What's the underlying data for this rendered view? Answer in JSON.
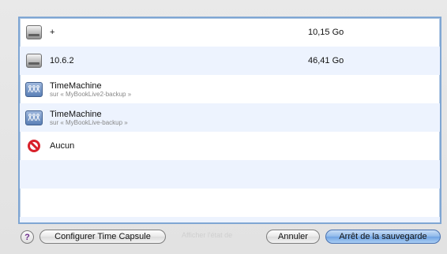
{
  "list": {
    "rows": [
      {
        "name": "+",
        "sub": "",
        "size": "10,15 Go",
        "icon": "hard-drive-icon"
      },
      {
        "name": "10.6.2",
        "sub": "",
        "size": "46,41 Go",
        "icon": "hard-drive-icon"
      },
      {
        "name": "TimeMachine",
        "sub": "sur « MyBookLive2-backup »",
        "size": "",
        "icon": "network-volume-icon"
      },
      {
        "name": "TimeMachine",
        "sub": "sur « MyBookLive-backup »",
        "size": "",
        "icon": "network-volume-icon"
      },
      {
        "name": "Aucun",
        "sub": "",
        "size": "",
        "icon": "no-entry-icon"
      }
    ]
  },
  "footer": {
    "help_label": "?",
    "configure_label": "Configurer Time Capsule",
    "ghost_label": "Afficher l'état de",
    "cancel_label": "Annuler",
    "stop_label": "Arrêt de la sauvegarde"
  },
  "colors": {
    "selection_border": "#7fa6d3",
    "alt_row": "#edf3fe",
    "primary_button": "#6fa3e3",
    "no_entry_red": "#d8212a"
  }
}
